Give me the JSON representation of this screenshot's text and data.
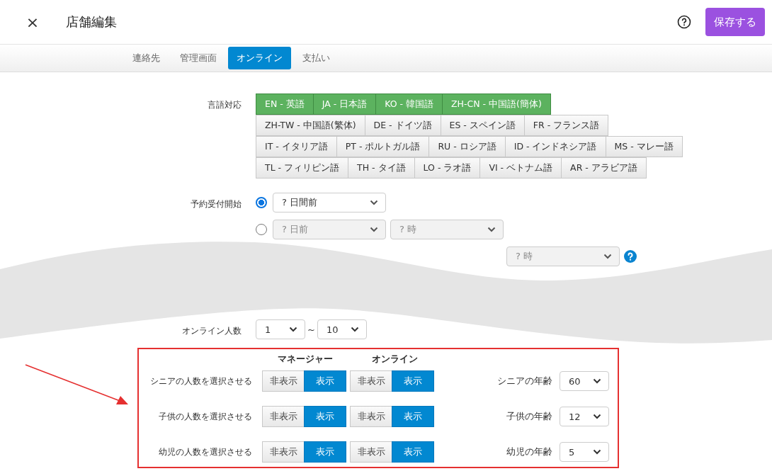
{
  "header": {
    "close_icon": "×",
    "title": "店舗編集",
    "save_button": "保存する"
  },
  "tabs": [
    {
      "label": "連絡先",
      "selected": false
    },
    {
      "label": "管理画面",
      "selected": false
    },
    {
      "label": "オンライン",
      "selected": true
    },
    {
      "label": "支払い",
      "selected": false
    }
  ],
  "languages": {
    "label": "言語対応",
    "rows": [
      [
        {
          "label": "EN - 英語",
          "selected": true
        },
        {
          "label": "JA - 日本語",
          "selected": true
        },
        {
          "label": "KO - 韓国語",
          "selected": true
        },
        {
          "label": "ZH-CN - 中国語(簡体)",
          "selected": true
        }
      ],
      [
        {
          "label": "ZH-TW - 中国語(繁体)",
          "selected": false
        },
        {
          "label": "DE - ドイツ語",
          "selected": false
        },
        {
          "label": "ES - スペイン語",
          "selected": false
        },
        {
          "label": "FR - フランス語",
          "selected": false
        }
      ],
      [
        {
          "label": "IT - イタリア語",
          "selected": false
        },
        {
          "label": "PT - ポルトガル語",
          "selected": false
        },
        {
          "label": "RU - ロシア語",
          "selected": false
        },
        {
          "label": "ID - インドネシア語",
          "selected": false
        },
        {
          "label": "MS - マレー語",
          "selected": false
        }
      ],
      [
        {
          "label": "TL - フィリピン語",
          "selected": false
        },
        {
          "label": "TH - タイ語",
          "selected": false
        },
        {
          "label": "LO - ラオ語",
          "selected": false
        },
        {
          "label": "VI - ベトナム語",
          "selected": false
        },
        {
          "label": "AR - アラビア語",
          "selected": false
        }
      ]
    ]
  },
  "booking_start": {
    "label": "予約受付開始",
    "options": [
      {
        "kind": "radio",
        "selected": true,
        "disabled": false,
        "selects": [
          "? 日間前"
        ]
      },
      {
        "kind": "radio",
        "selected": false,
        "disabled": true,
        "selects": [
          "? 日前",
          "? 時"
        ]
      },
      {
        "kind": "partial",
        "disabled": true,
        "selects": [
          "? 時"
        ],
        "help": true
      }
    ]
  },
  "online_count": {
    "label": "オンライン人数",
    "from": "1",
    "separator": "~",
    "to": "10"
  },
  "display_settings": {
    "columns": [
      "マネージャー",
      "オンライン"
    ],
    "rows": [
      {
        "label": "シニアの人数を選択させる",
        "manager": [
          {
            "label": "非表示",
            "selected": false
          },
          {
            "label": "表示",
            "selected": true
          }
        ],
        "online": [
          {
            "label": "非表示",
            "selected": false
          },
          {
            "label": "表示",
            "selected": true
          }
        ],
        "age_label": "シニアの年齢",
        "age": "60"
      },
      {
        "label": "子供の人数を選択させる",
        "manager": [
          {
            "label": "非表示",
            "selected": false
          },
          {
            "label": "表示",
            "selected": true
          }
        ],
        "online": [
          {
            "label": "非表示",
            "selected": false
          },
          {
            "label": "表示",
            "selected": true
          }
        ],
        "age_label": "子供の年齢",
        "age": "12"
      },
      {
        "label": "幼児の人数を選択させる",
        "manager": [
          {
            "label": "非表示",
            "selected": false
          },
          {
            "label": "表示",
            "selected": true
          }
        ],
        "online": [
          {
            "label": "非表示",
            "selected": false
          },
          {
            "label": "表示",
            "selected": true
          }
        ],
        "age_label": "幼児の年齢",
        "age": "5"
      }
    ]
  }
}
